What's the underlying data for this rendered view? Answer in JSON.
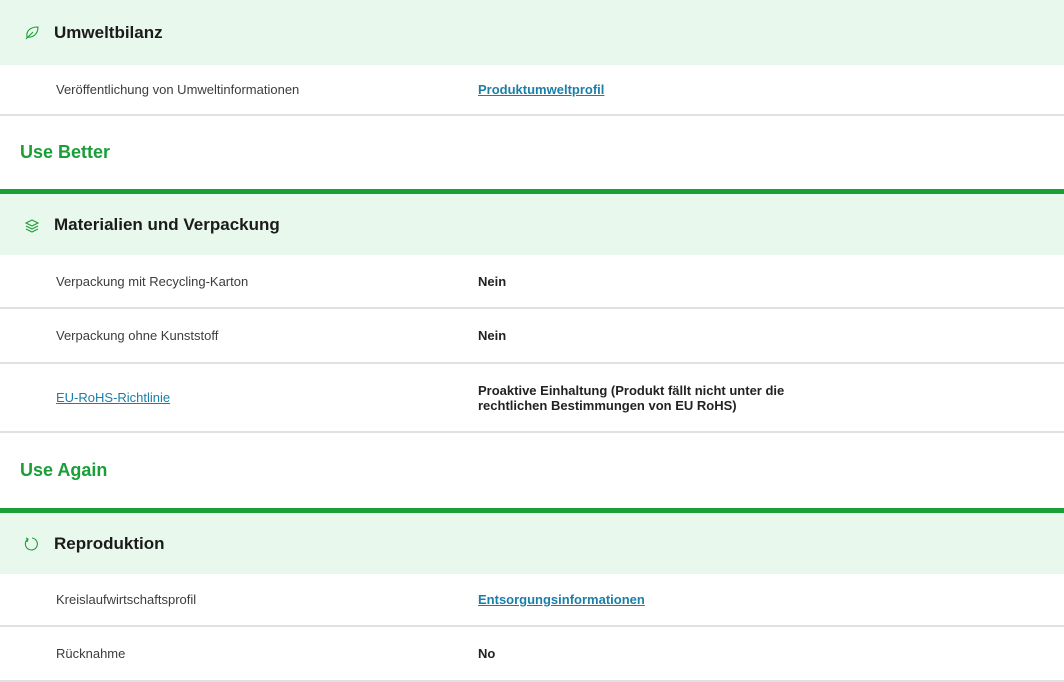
{
  "colors": {
    "accent_green": "#1a9e37",
    "header_bg": "#e9f8ec",
    "link": "#1a7fa8"
  },
  "umweltbilanz": {
    "title": "Umweltbilanz",
    "icon": "leaf-icon",
    "rows": [
      {
        "label": "Veröffentlichung von Umweltinformationen",
        "value": "Produktumweltprofil"
      }
    ]
  },
  "use_better": {
    "heading": "Use Better",
    "section": {
      "title": "Materialien und Verpackung",
      "icon": "layers-icon",
      "rows": [
        {
          "label": "Verpackung mit Recycling-Karton",
          "value": "Nein"
        },
        {
          "label": "Verpackung ohne Kunststoff",
          "value": "Nein"
        },
        {
          "label": "EU-RoHS-Richtlinie",
          "value_line1": "Proaktive Einhaltung (Produkt fällt nicht unter die",
          "value_line2": "rechtlichen Bestimmungen von EU RoHS)"
        }
      ]
    }
  },
  "use_again": {
    "heading": "Use Again",
    "section": {
      "title": "Reproduktion",
      "icon": "refresh-icon",
      "rows": [
        {
          "label": "Kreislaufwirtschaftsprofil",
          "value": "Entsorgungsinformationen"
        },
        {
          "label": "Rücknahme",
          "value": "No"
        }
      ]
    }
  }
}
